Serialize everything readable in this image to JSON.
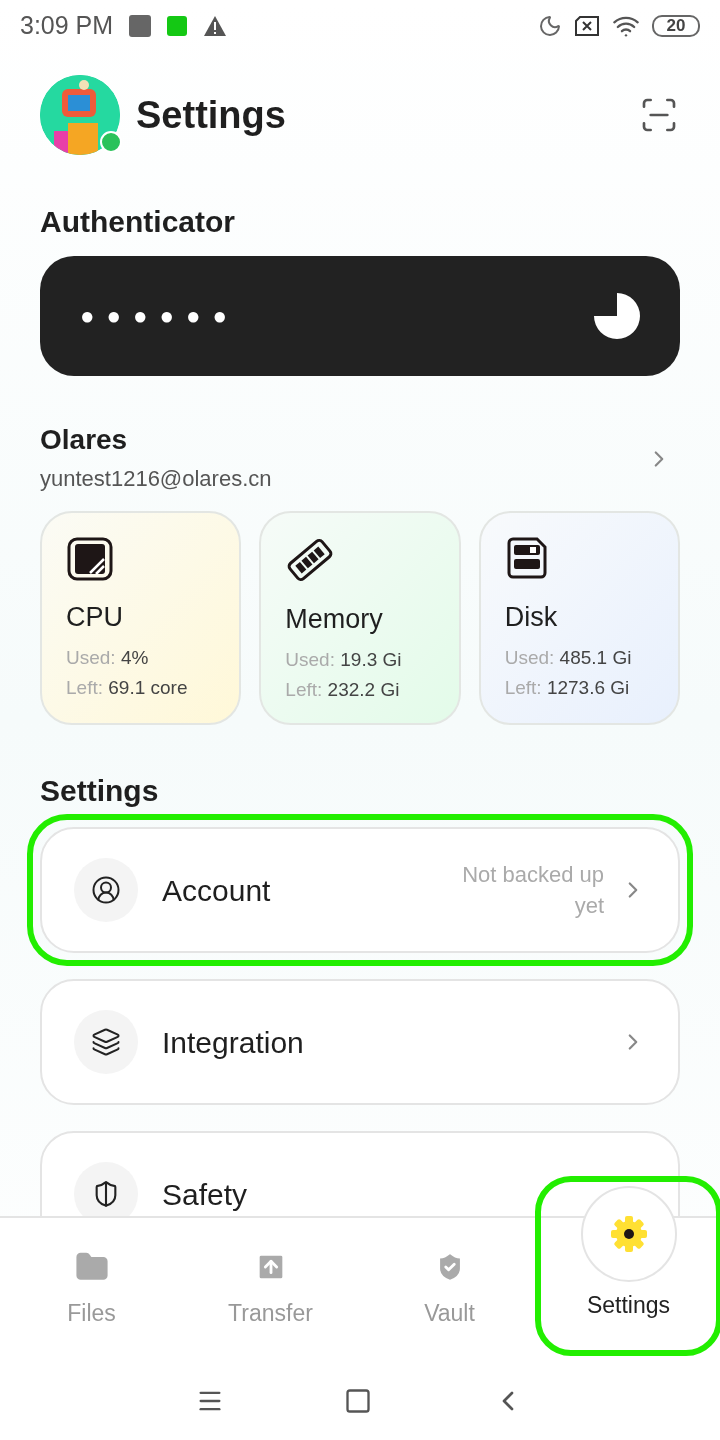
{
  "status_bar": {
    "time": "3:09 PM",
    "battery": "20"
  },
  "header": {
    "title": "Settings",
    "online": true
  },
  "authenticator": {
    "heading": "Authenticator",
    "code": "●●●●●●"
  },
  "account": {
    "name": "Olares",
    "email": "yuntest1216@olares.cn"
  },
  "resources": [
    {
      "kind": "cpu",
      "title": "CPU",
      "used_label": "Used:",
      "used": "4%",
      "left_label": "Left:",
      "left": "69.1 core"
    },
    {
      "kind": "memory",
      "title": "Memory",
      "used_label": "Used:",
      "used": "19.3 Gi",
      "left_label": "Left:",
      "left": "232.2 Gi"
    },
    {
      "kind": "disk",
      "title": "Disk",
      "used_label": "Used:",
      "used": "485.1 Gi",
      "left_label": "Left:",
      "left": "1273.6 Gi"
    }
  ],
  "settings": {
    "heading": "Settings",
    "items": [
      {
        "kind": "account",
        "label": "Account",
        "note": "Not backed up yet",
        "highlighted": true,
        "chevron": true
      },
      {
        "kind": "integration",
        "label": "Integration",
        "highlighted": false,
        "chevron": true
      },
      {
        "kind": "safety",
        "label": "Safety",
        "highlighted": false,
        "chevron": false
      }
    ]
  },
  "nav": [
    {
      "kind": "files",
      "label": "Files",
      "selected": false,
      "highlighted": false
    },
    {
      "kind": "transfer",
      "label": "Transfer",
      "selected": false,
      "highlighted": false
    },
    {
      "kind": "vault",
      "label": "Vault",
      "selected": false,
      "highlighted": false
    },
    {
      "kind": "settings",
      "label": "Settings",
      "selected": true,
      "highlighted": true
    }
  ]
}
